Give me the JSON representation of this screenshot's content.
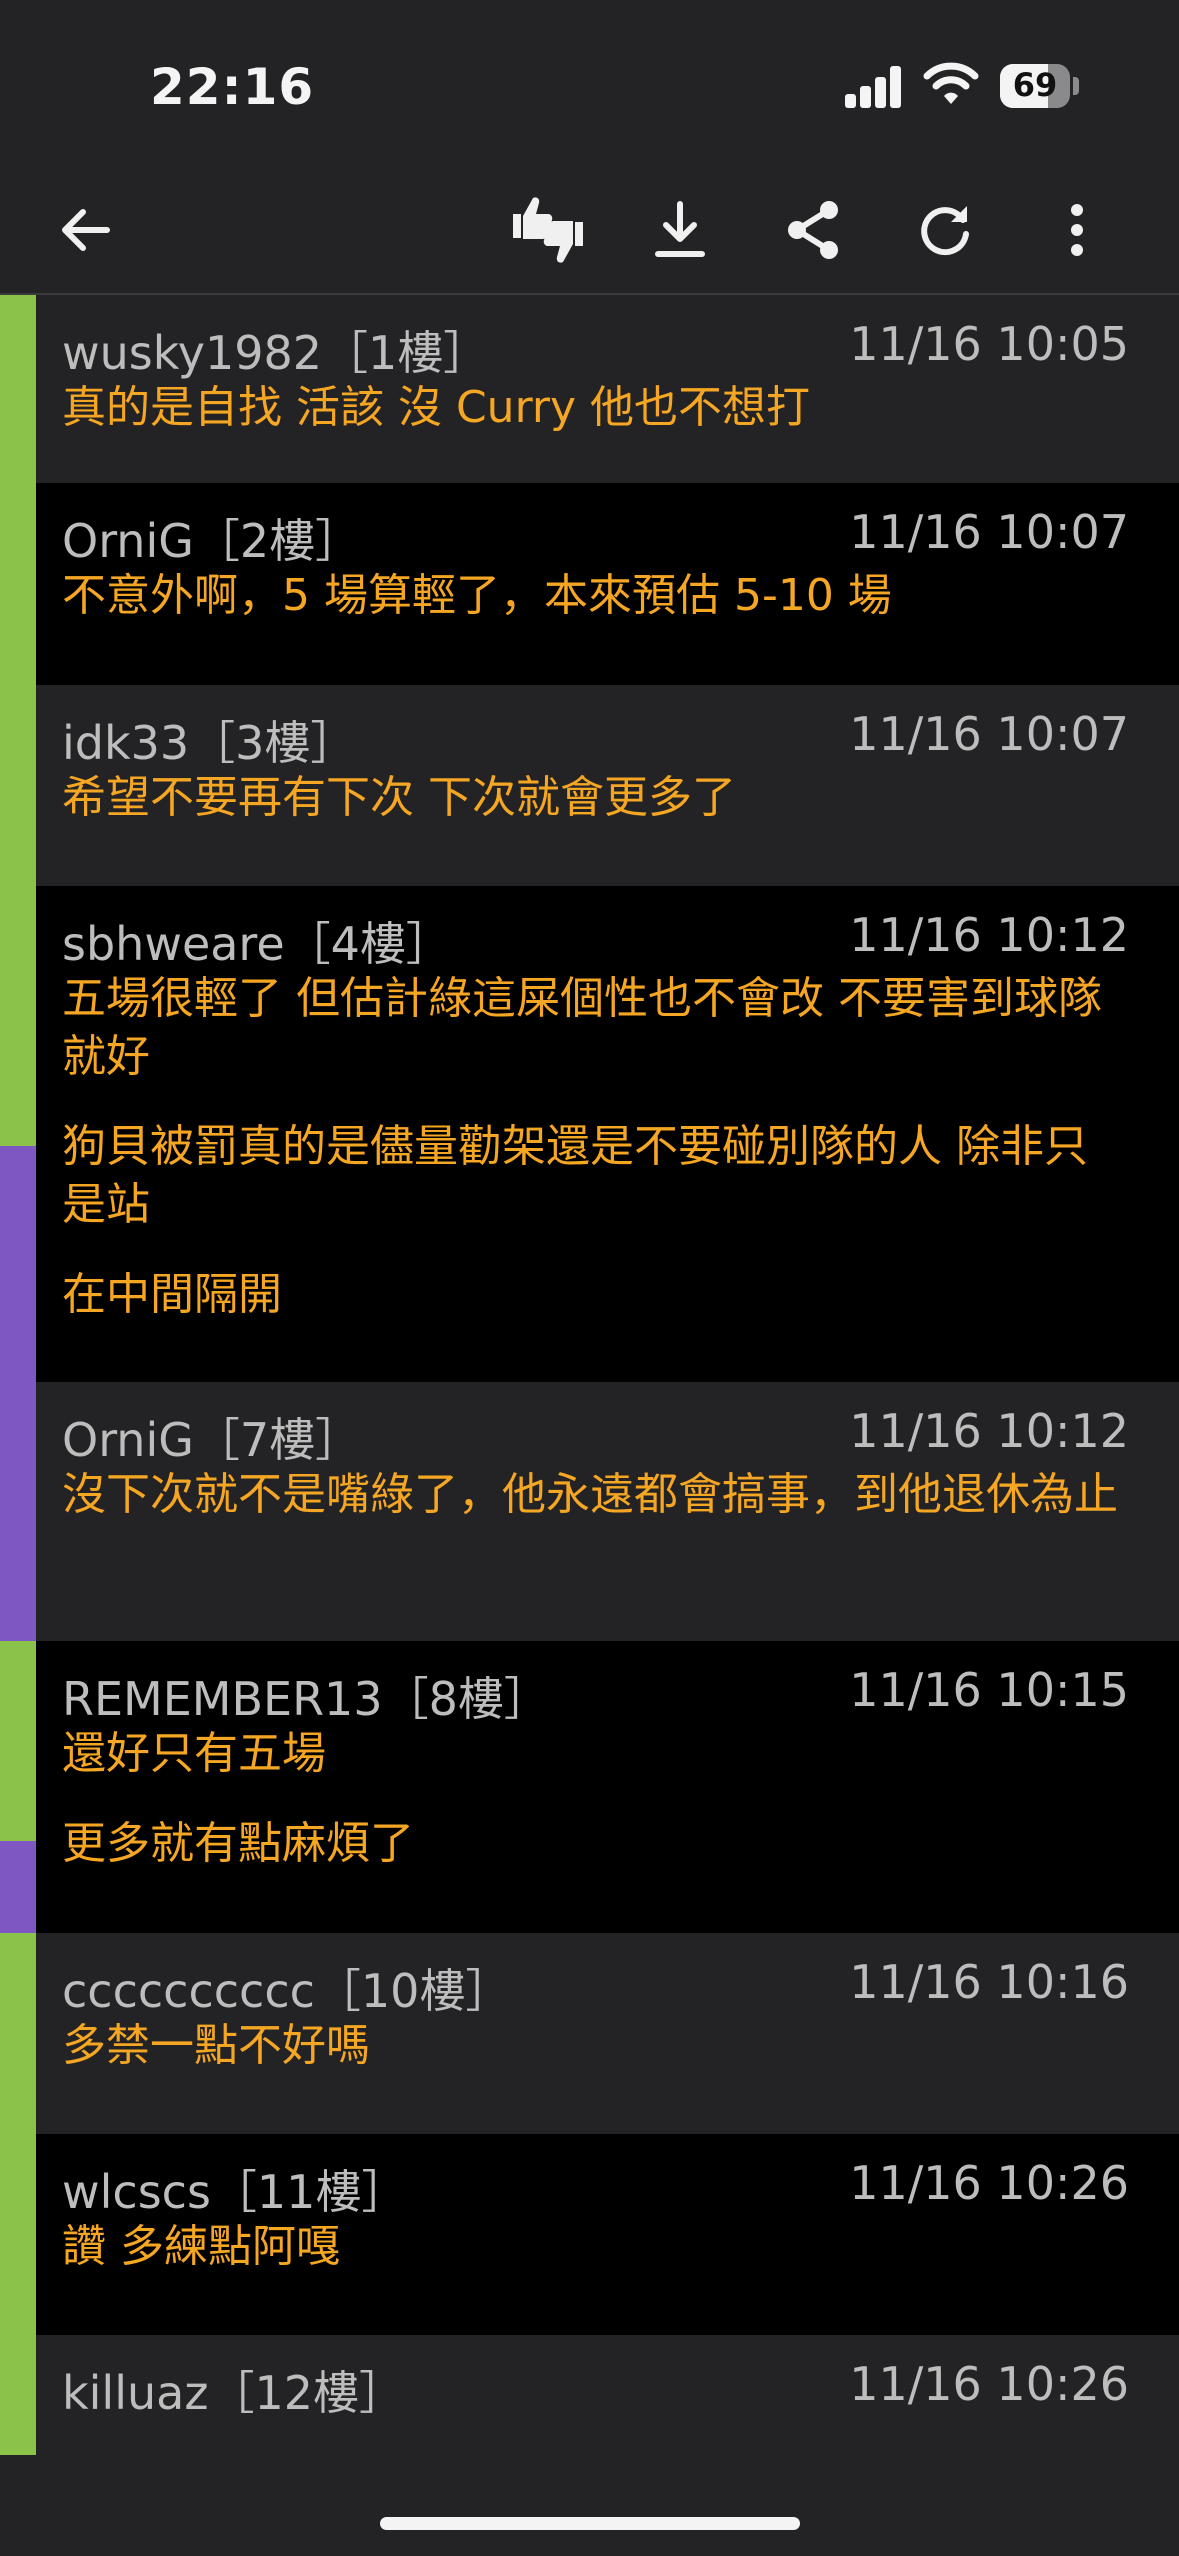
{
  "status": {
    "time": "22:16",
    "battery_level": "69",
    "battery_fraction": 0.69
  },
  "toolbar": {
    "back": "back-arrow-icon",
    "rate": "thumbs-up-down-icon",
    "download": "download-icon",
    "share": "share-icon",
    "refresh": "refresh-icon",
    "more": "more-vertical-icon"
  },
  "colors": {
    "accent_text": "#f5a623",
    "green_bar": "#8bc34a",
    "purple_bar": "#7e57c2",
    "header_bg": "#232325"
  },
  "posts": [
    {
      "author": "wusky1982［1樓］",
      "date": "11/16 10:05",
      "paragraphs": [
        "真的是自找 活該 沒 Curry 他也不想打"
      ]
    },
    {
      "author": "OrniG［2樓］",
      "date": "11/16 10:07",
      "paragraphs": [
        "不意外啊，5 場算輕了，本來預估 5-10 場"
      ]
    },
    {
      "author": "idk33［3樓］",
      "date": "11/16 10:07",
      "paragraphs": [
        "希望不要再有下次 下次就會更多了"
      ]
    },
    {
      "author": "sbhweare［4樓］",
      "date": "11/16 10:12",
      "paragraphs": [
        "五場很輕了 但估計綠這屎個性也不會改 不要害到球隊就好",
        "狗貝被罰真的是儘量勸架還是不要碰別隊的人 除非只是站",
        "在中間隔開"
      ]
    },
    {
      "author": "OrniG［7樓］",
      "date": "11/16 10:12",
      "paragraphs": [
        "沒下次就不是嘴綠了，他永遠都會搞事，到他退休為止"
      ]
    },
    {
      "author": "REMEMBER13［8樓］",
      "date": "11/16 10:15",
      "paragraphs": [
        "還好只有五場",
        "更多就有點麻煩了"
      ]
    },
    {
      "author": "cccccccccc［10樓］",
      "date": "11/16 10:16",
      "paragraphs": [
        "多禁一點不好嗎"
      ]
    },
    {
      "author": "wlcscs［11樓］",
      "date": "11/16 10:26",
      "paragraphs": [
        "讚 多練點阿嘎"
      ]
    },
    {
      "author": "killuaz［12樓］",
      "date": "11/16 10:26",
      "paragraphs": []
    }
  ]
}
